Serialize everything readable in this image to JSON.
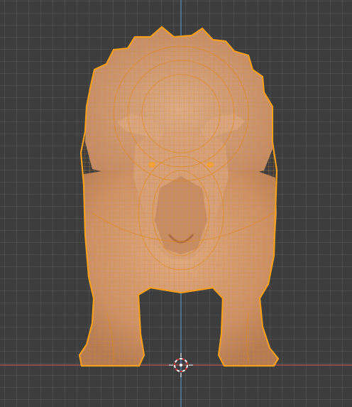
{
  "viewport": {
    "background": "#3d3d3d",
    "grid_color": "#4a4a4a",
    "axis_y_color": "#5a8fc7",
    "axis_x_color": "#b55a5a",
    "selection_outline_color": "#f59f1f",
    "wire_color": "#e0891b",
    "mesh_face_color": "#d49b72"
  },
  "scene": {
    "object": "triceratops-mesh",
    "mode": "edit-mode-wireframe",
    "cursor": "3d-cursor-icon"
  }
}
